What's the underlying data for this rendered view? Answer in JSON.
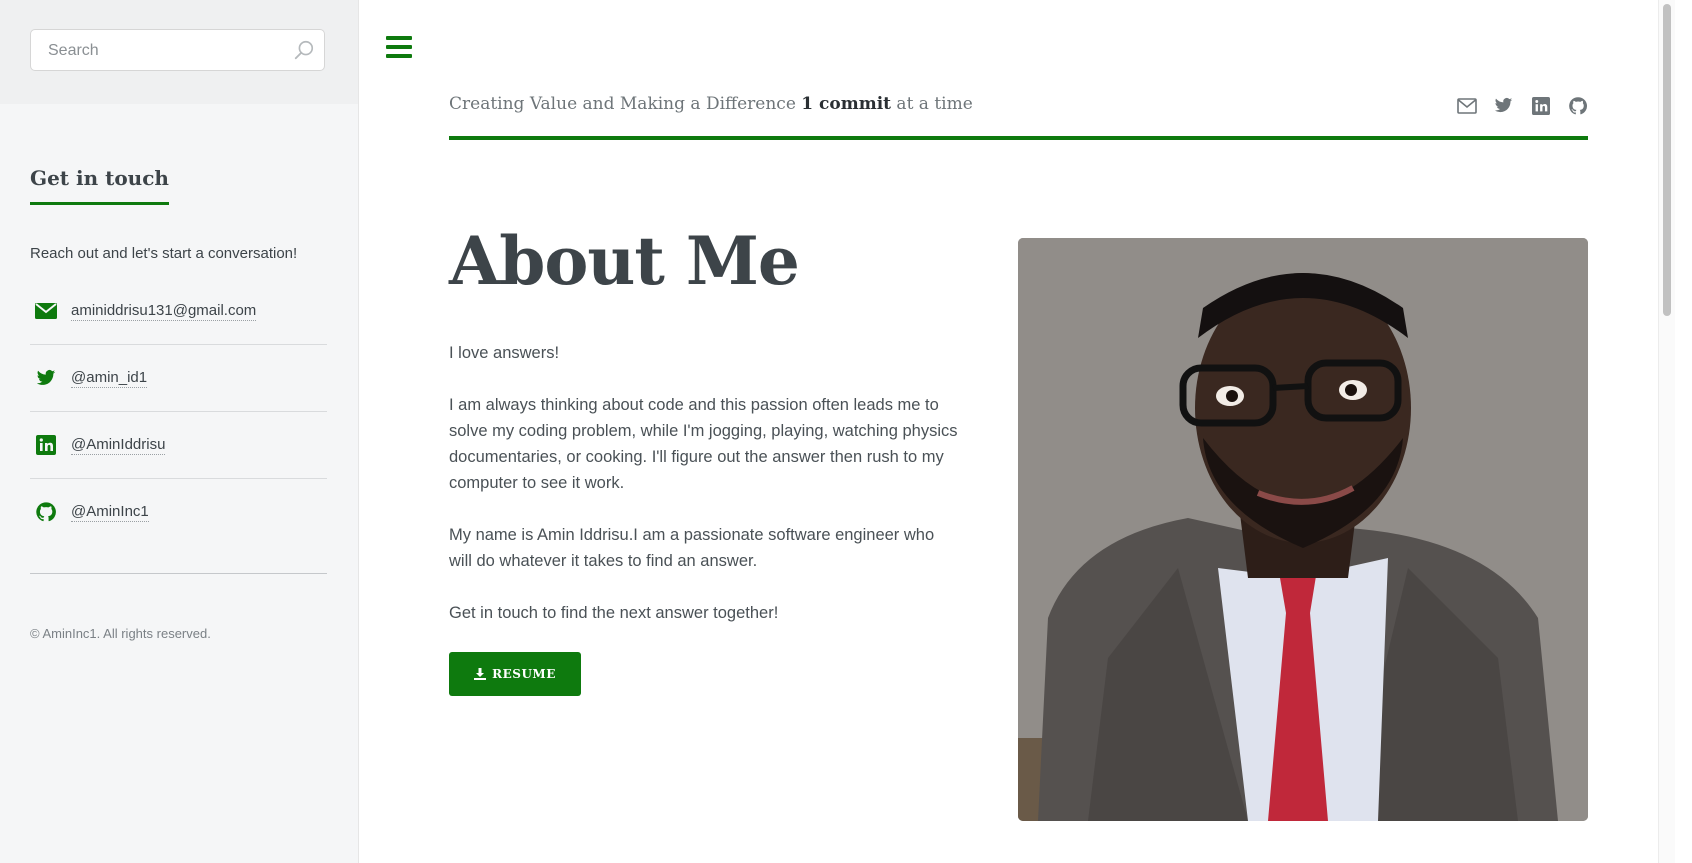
{
  "search": {
    "placeholder": "Search"
  },
  "sidebar": {
    "heading": "Get in touch",
    "intro": "Reach out and let's start a conversation!",
    "contacts": [
      {
        "icon": "envelope-icon",
        "label": "aminiddrisu131@gmail.com"
      },
      {
        "icon": "twitter-icon",
        "label": "@amin_id1"
      },
      {
        "icon": "linkedin-icon",
        "label": "@AminIddrisu"
      },
      {
        "icon": "github-icon",
        "label": "@AminInc1"
      }
    ],
    "copyright": "© AminInc1. All rights reserved."
  },
  "header": {
    "tagline_start": "Creating Value and Making a Difference ",
    "tagline_bold": "1 commit",
    "tagline_end": " at a time",
    "social_icons": [
      "envelope-icon",
      "twitter-icon",
      "linkedin-icon",
      "github-icon"
    ]
  },
  "about": {
    "title": "About Me",
    "paragraphs": [
      "I love answers!",
      "I am always thinking about code and this passion often leads me to solve my coding problem, while I'm jogging, playing, watching physics documentaries, or cooking. I'll figure out the answer then rush to my computer to see it work.",
      "My name is Amin Iddrisu.I am a passionate software engineer who will do whatever it takes to find an answer.",
      "Get in touch to find the next answer together!"
    ],
    "resume_label": "RESUME"
  },
  "colors": {
    "accent": "#0e7a0e",
    "text": "#3d4449",
    "sidebar_bg": "#f5f6f7"
  }
}
